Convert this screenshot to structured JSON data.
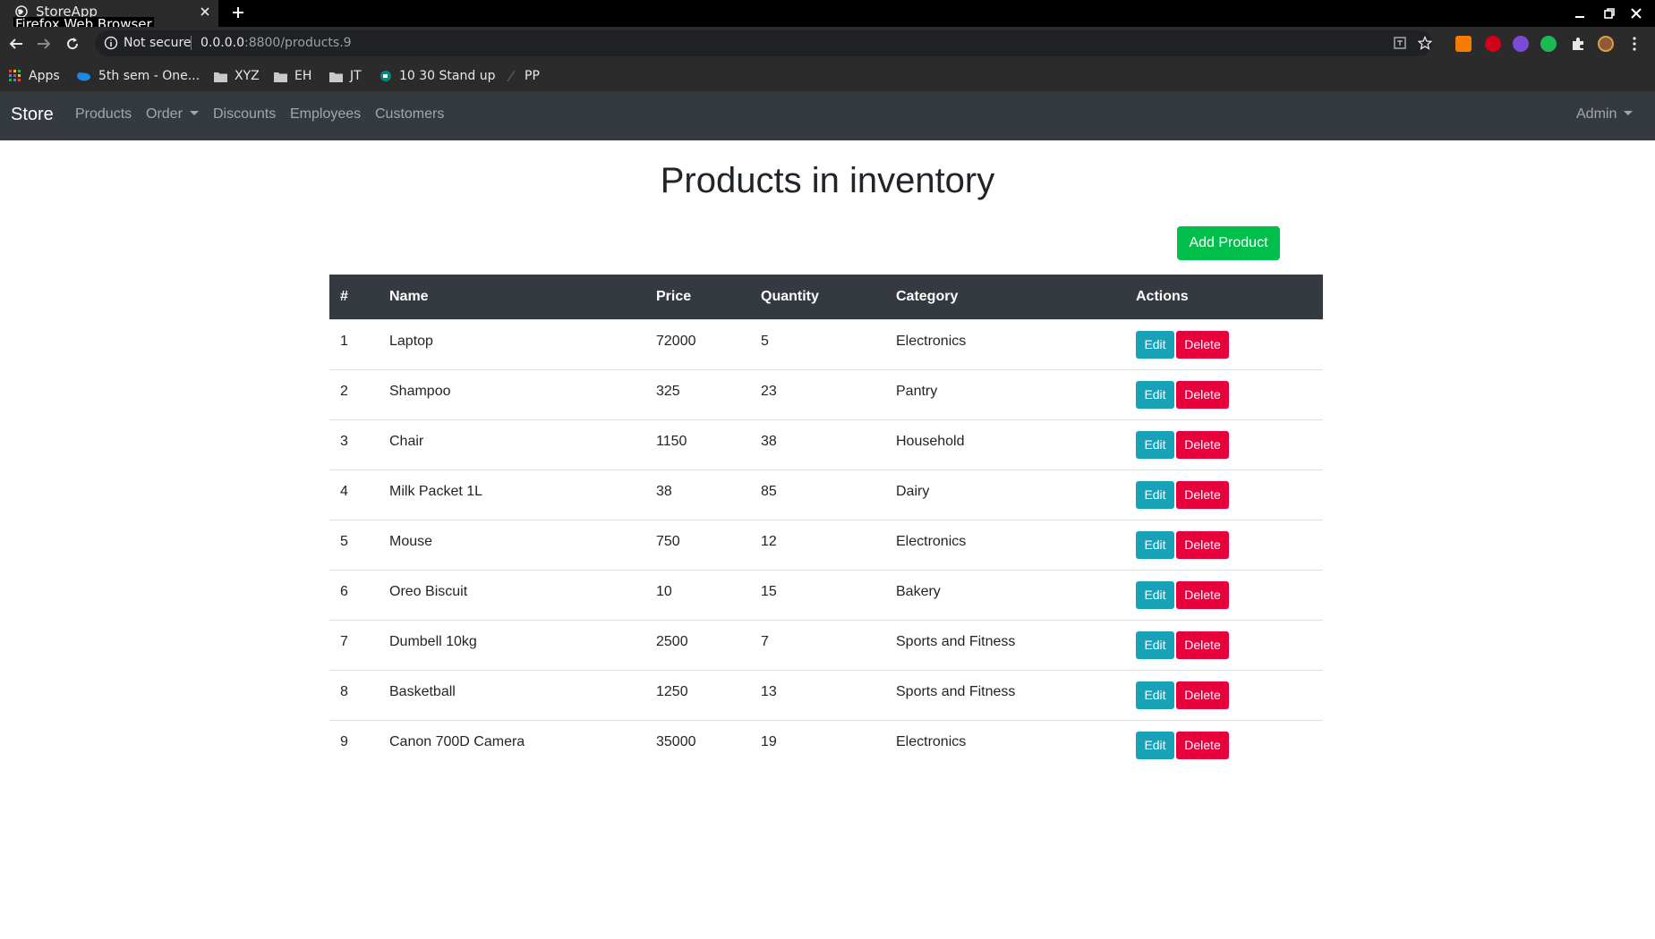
{
  "browser": {
    "tab_title": "StoreApp",
    "tooltip": "Firefox Web Browser",
    "security_label": "Not secure",
    "url_host": "0.0.0.0",
    "url_rest": ":8800/products.9",
    "bookmarks": [
      "Apps",
      "5th sem - One...",
      "XYZ",
      "EH",
      "JT",
      "10 30 Stand up",
      "PP"
    ]
  },
  "navbar": {
    "brand": "Store",
    "links": [
      "Products",
      "Order",
      "Discounts",
      "Employees",
      "Customers"
    ],
    "user": "Admin"
  },
  "main": {
    "title": "Products in inventory",
    "add_button": "Add Product",
    "columns": [
      "#",
      "Name",
      "Price",
      "Quantity",
      "Category",
      "Actions"
    ],
    "edit_label": "Edit",
    "delete_label": "Delete",
    "rows": [
      [
        "1",
        "Laptop",
        "72000",
        "5",
        "Electronics"
      ],
      [
        "2",
        "Shampoo",
        "325",
        "23",
        "Pantry"
      ],
      [
        "3",
        "Chair",
        "1150",
        "38",
        "Household"
      ],
      [
        "4",
        "Milk Packet 1L",
        "38",
        "85",
        "Dairy"
      ],
      [
        "5",
        "Mouse",
        "750",
        "12",
        "Electronics"
      ],
      [
        "6",
        "Oreo Biscuit",
        "10",
        "15",
        "Bakery"
      ],
      [
        "7",
        "Dumbell 10kg",
        "2500",
        "7",
        "Sports and Fitness"
      ],
      [
        "8",
        "Basketball",
        "1250",
        "13",
        "Sports and Fitness"
      ],
      [
        "9",
        "Canon 700D Camera",
        "35000",
        "19",
        "Electronics"
      ]
    ]
  },
  "colors": {
    "navbar_bg": "#343a40",
    "add_button": "#00c04b",
    "edit_button": "#17a2b8",
    "delete_button": "#e8003d"
  }
}
